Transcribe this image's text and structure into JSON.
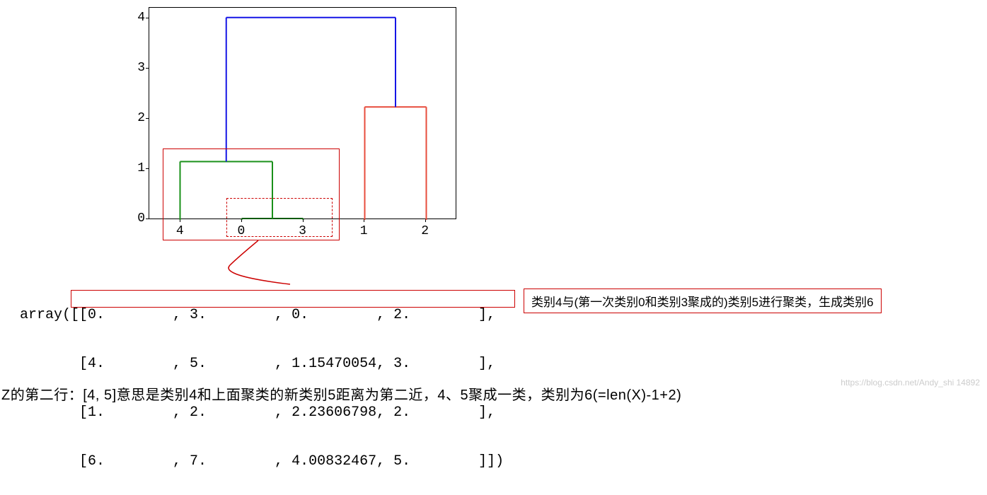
{
  "chart_data": {
    "type": "dendrogram",
    "x_labels": [
      "4",
      "0",
      "3",
      "1",
      "2"
    ],
    "y_ticks": [
      0,
      1,
      2,
      3,
      4
    ],
    "x_range": [
      0,
      50
    ],
    "y_range": [
      0,
      4.2
    ],
    "linkage_matrix": [
      [
        0,
        3,
        0.0,
        2
      ],
      [
        4,
        5,
        1.15470054,
        3
      ],
      [
        1,
        2,
        2.23606798,
        2
      ],
      [
        6,
        7,
        4.00832467,
        5
      ]
    ],
    "clusters": [
      {
        "leaves": [
          "0",
          "3"
        ],
        "height": 0.02,
        "x_left": 15,
        "x_right": 25,
        "color": "darkgreen"
      },
      {
        "leaves": [
          "4",
          "(0,3)"
        ],
        "height": 1.1547,
        "x_left": 5,
        "x_right": 20,
        "color": "green"
      },
      {
        "leaves": [
          "1",
          "2"
        ],
        "height": 2.236,
        "x_left": 35,
        "x_right": 45,
        "color": "red"
      },
      {
        "leaves": [
          "all"
        ],
        "height": 4.008,
        "x_left": 12.5,
        "x_right": 40,
        "color": "blue"
      }
    ]
  },
  "array_text": {
    "prefix": "array([[0.        , 3.        , 0.        , 2.        ],",
    "row2": "       [4.        , 5.        , 1.15470054, 3.        ],",
    "row3": "       [1.        , 2.        , 2.23606798, 2.        ],",
    "row4": "       [6.        , 7.        , 4.00832467, 5.        ]])"
  },
  "annotation": "类别4与(第一次类别0和类别3聚成的)类别5进行聚类，生成类别6",
  "bottom_caption": "Z的第二行：[4, 5]意思是类别4和上面聚类的新类别5距离为第二近，4、5聚成一类，类别为6(=len(X)-1+2)",
  "watermark": "https://blog.csdn.net/Andy_shi    14892"
}
